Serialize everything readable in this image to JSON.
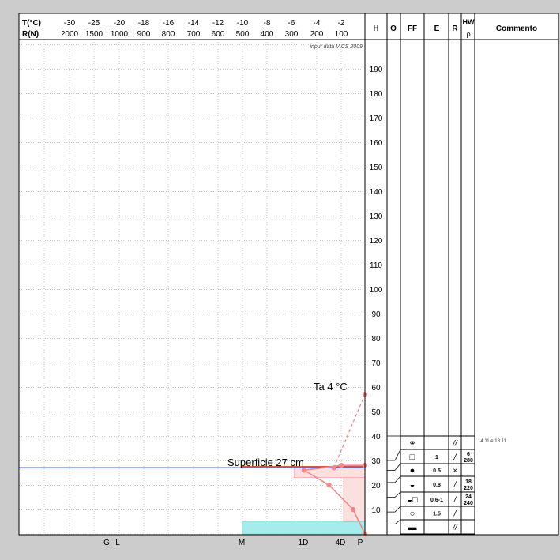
{
  "header": {
    "t_label": "T(°C)",
    "r_label": "R(N)",
    "t_ticks": [
      "-30",
      "-25",
      "-20",
      "-18",
      "-16",
      "-14",
      "-12",
      "-10",
      "-8",
      "-6",
      "-4",
      "-2"
    ],
    "r_ticks": [
      "2000",
      "1500",
      "1000",
      "900",
      "800",
      "700",
      "600",
      "500",
      "400",
      "300",
      "200",
      "100"
    ],
    "columns": {
      "h": "H",
      "theta": "Θ",
      "ff": "FF",
      "e": "E",
      "r": "R",
      "hw": "HW",
      "rho": "ρ",
      "commento": "Commento"
    },
    "source_note": "input data IACS 2009"
  },
  "colors": {
    "background": "#cccccc",
    "grid_dotted": "#c8c8c8",
    "temperature_line": "#ee8a8a",
    "ram_fill": "#fbe0e0",
    "ram_line": "#e89a9a",
    "snow_surface_line": "#2233aa",
    "snow_surface_marker": "#d05555",
    "ground_bar": "#a6ecec",
    "border": "#000000"
  },
  "annotations": {
    "air_temperature": "Ta  4 °C",
    "snow_surface": "Superficie  27 cm"
  },
  "bottom_labels": [
    "G",
    "L",
    "M",
    "1D",
    "4D",
    "P"
  ],
  "comment_text": "14.11 e 18.11",
  "chart_data": {
    "type": "line",
    "y_axis": {
      "label": "H",
      "unit": "cm",
      "ticks": [
        10,
        20,
        30,
        40,
        50,
        60,
        70,
        80,
        90,
        100,
        110,
        120,
        130,
        140,
        150,
        160,
        170,
        180,
        190
      ],
      "ylim": [
        0,
        200
      ]
    },
    "x_axis_temperature": {
      "label": "T(°C)",
      "ticks": [
        -30,
        -25,
        -20,
        -18,
        -16,
        -14,
        -12,
        -10,
        -8,
        -6,
        -4,
        -2
      ],
      "xlim": [
        -31,
        0
      ]
    },
    "x_axis_ram": {
      "label": "R(N)",
      "ticks": [
        2000,
        1500,
        1000,
        900,
        800,
        700,
        600,
        500,
        400,
        300,
        200,
        100
      ]
    },
    "grid": true,
    "series": [
      {
        "name": "Ta  4 °C",
        "style": "dashed",
        "points": [
          {
            "t": -2.6,
            "h": 27
          },
          {
            "t": 0,
            "h": 57
          }
        ]
      },
      {
        "name": "",
        "style": "solid",
        "points": [
          {
            "t": 0,
            "h": 0
          },
          {
            "t": -1,
            "h": 10
          },
          {
            "t": -3,
            "h": 20
          },
          {
            "t": -5,
            "h": 26
          },
          {
            "t": -2,
            "h": 28
          },
          {
            "t": 0,
            "h": 28
          }
        ]
      }
    ],
    "ram_profile": [
      {
        "h_bottom": 0,
        "h_top": 5,
        "r_at_right_edge": 30
      },
      {
        "h_bottom": 5,
        "h_top": 26,
        "r_at_right_edge": 90
      },
      {
        "h_bottom": 23,
        "h_top": 27,
        "r_at_right_edge": 290
      },
      {
        "h_bottom": 27,
        "h_top": 28,
        "r_at_right_edge": 100
      }
    ],
    "snow_surface_height": 27,
    "ground_bar": {
      "h_bottom": 0,
      "h_top": 3,
      "r_left": 500,
      "r_right": 0
    },
    "layers": [
      {
        "h_top": 40,
        "h_bottom": 30,
        "grain": "⚭",
        "size": "",
        "wetness": "//",
        "hardness": "",
        "density": ""
      },
      {
        "h_top": 30,
        "h_bottom": 26,
        "grain": "□",
        "size": "1",
        "wetness": "/",
        "hardness": "6",
        "density": "280"
      },
      {
        "h_top": 26,
        "h_bottom": 21,
        "grain": "●",
        "size": "0.5",
        "wetness": "×",
        "hardness": "",
        "density": ""
      },
      {
        "h_top": 21,
        "h_bottom": 15,
        "grain": "◒",
        "size": "0.8",
        "wetness": "/",
        "hardness": "18",
        "density": "220"
      },
      {
        "h_top": 15,
        "h_bottom": 9,
        "grain": "◒□",
        "size": "0.6-1",
        "wetness": "/",
        "hardness": "24",
        "density": "240"
      },
      {
        "h_top": 9,
        "h_bottom": 4,
        "grain": "○",
        "size": "1.5",
        "wetness": "/",
        "hardness": "",
        "density": ""
      },
      {
        "h_top": 4,
        "h_bottom": 0,
        "grain": "▬",
        "size": "",
        "wetness": "//",
        "hardness": "",
        "density": ""
      }
    ]
  }
}
